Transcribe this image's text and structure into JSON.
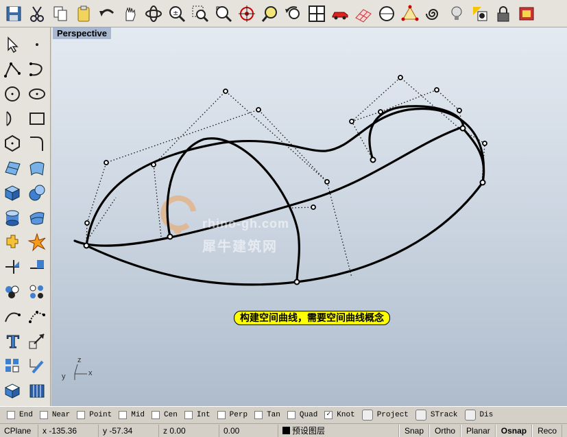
{
  "toolbar": {
    "icons": [
      "save-icon",
      "cut-icon",
      "copy-icon",
      "paste-icon",
      "undo-icon",
      "pan-hand-icon",
      "rotate-view-icon",
      "zoom-dynamic-icon",
      "zoom-window-icon",
      "zoom-extents-icon",
      "zoom-target-icon",
      "zoom-selected-icon",
      "undo-view-icon",
      "four-viewports-icon",
      "car-icon",
      "grid-plane-icon",
      "cplane-icon",
      "point-snap-icon",
      "spiral-icon",
      "lightbulb-icon",
      "properties-icon",
      "lock-icon",
      "render-icon"
    ]
  },
  "left_tools": {
    "icons": [
      "select-arrow-icon",
      "point-icon",
      "polyline-icon",
      "curve-icon",
      "circle-icon",
      "ellipse-icon",
      "arc-icon",
      "rectangle-icon",
      "polygon-icon",
      "fillet-curve-icon",
      "surface-icon",
      "loft-surface-icon",
      "box-icon",
      "sphere-icon",
      "cylinder-icon",
      "nurbs-surface-icon",
      "boolean-icon",
      "explode-icon",
      "dimension-icon",
      "split-icon",
      "group-icon",
      "point-cloud-icon",
      "offset-curve-icon",
      "edit-points-icon",
      "text-icon",
      "scale-icon",
      "block-icon",
      "array-icon",
      "solid-tools-icon",
      "hatch-icon"
    ]
  },
  "viewport": {
    "title": "Perspective",
    "watermark_url": "rhino-gh.com",
    "watermark_cn": "犀牛建筑网",
    "caption": "构建空间曲线，需要空间曲线概念",
    "axis_x": "x",
    "axis_y": "y",
    "axis_z": "z"
  },
  "osnap": [
    {
      "label": "End",
      "checked": false
    },
    {
      "label": "Near",
      "checked": false
    },
    {
      "label": "Point",
      "checked": false
    },
    {
      "label": "Mid",
      "checked": false
    },
    {
      "label": "Cen",
      "checked": false
    },
    {
      "label": "Int",
      "checked": false
    },
    {
      "label": "Perp",
      "checked": false
    },
    {
      "label": "Tan",
      "checked": false
    },
    {
      "label": "Quad",
      "checked": false
    },
    {
      "label": "Knot",
      "checked": true
    },
    {
      "label": "Project",
      "checked": false
    },
    {
      "label": "STrack",
      "checked": false
    },
    {
      "label": "Dis",
      "checked": false
    }
  ],
  "status": {
    "cplane": "CPlane",
    "x": "x -135.36",
    "y": "y -57.34",
    "z": "z 0.00",
    "distance": "0.00",
    "layer": "预设图层",
    "snap": "Snap",
    "ortho": "Ortho",
    "planar": "Planar",
    "osnap": "Osnap",
    "record": "Reco"
  },
  "colors": {
    "viewport_top": "#e4eaf1",
    "viewport_bottom": "#aebccc",
    "caption_bg": "#ffff00",
    "title_tab": "#a7b8d0"
  }
}
